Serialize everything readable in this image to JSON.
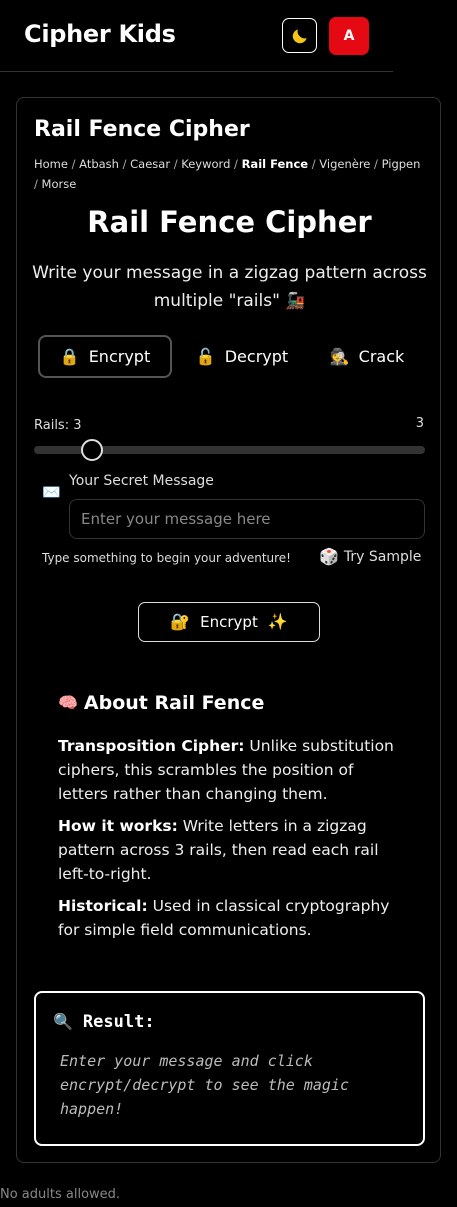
{
  "header": {
    "app_title": "Cipher Kids",
    "theme_icon": "moon-icon",
    "avatar_letter": "A",
    "accent_color": "#e50914"
  },
  "card": {
    "title": "Rail Fence Cipher",
    "breadcrumb": [
      "Home",
      "Atbash",
      "Caesar",
      "Keyword",
      "Rail Fence",
      "Vigenère",
      "Pigpen",
      "Morse"
    ],
    "breadcrumb_current": "Rail Fence"
  },
  "main": {
    "title": "Rail Fence Cipher",
    "subtitle": "Write your message in a zigzag pattern across multiple \"rails\"",
    "subtitle_emoji": "🚂"
  },
  "modes": [
    {
      "emoji": "🔒",
      "label": "Encrypt",
      "active": true
    },
    {
      "emoji": "🔓",
      "label": "Decrypt",
      "active": false
    },
    {
      "emoji": "🕵️",
      "label": "Crack",
      "active": false
    }
  ],
  "rails": {
    "label": "Rails: 3",
    "value": "3",
    "min": 2,
    "max": 10,
    "current": 3
  },
  "message": {
    "icon": "✉️",
    "label": "Your Secret Message",
    "placeholder": "Enter your message here",
    "value": ""
  },
  "hint": "Type something to begin your adventure!",
  "try_sample": {
    "emoji": "🎲",
    "label": "Try Sample"
  },
  "action": {
    "emoji_left": "🔐",
    "label": "Encrypt",
    "emoji_right": "✨"
  },
  "about": {
    "emoji": "🧠",
    "title": "About Rail Fence",
    "items": [
      {
        "term": "Transposition Cipher:",
        "text": " Unlike substitution ciphers, this scrambles the position of letters rather than changing them."
      },
      {
        "term": "How it works:",
        "text": " Write letters in a zigzag pattern across 3 rails, then read each rail left-to-right."
      },
      {
        "term": "Historical:",
        "text": " Used in classical cryptography for simple field communications."
      }
    ]
  },
  "result": {
    "emoji": "🔍",
    "title": "Result:",
    "placeholder": "Enter your message and click encrypt/decrypt to see the magic happen!"
  },
  "footer": "No adults allowed."
}
